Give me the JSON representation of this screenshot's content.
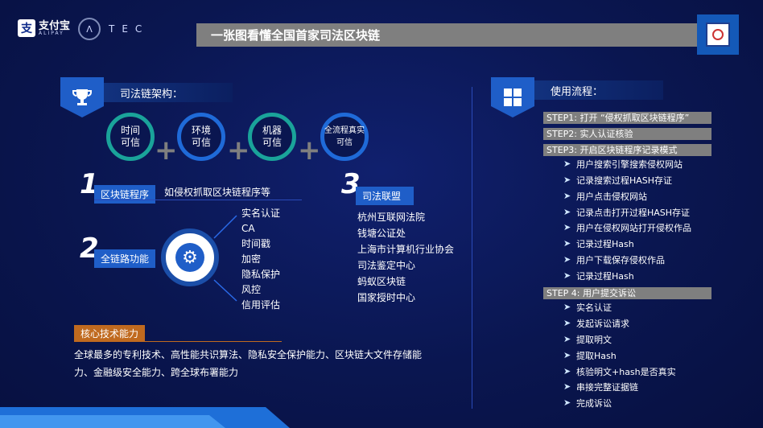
{
  "header": {
    "alipay_cn": "支付宝",
    "alipay_en": "ALIPAY",
    "alipay_mark": "支",
    "atec_mark": "Λ",
    "atec_text": "TEC",
    "title": "一张图看懂全国首家司法区块链"
  },
  "architecture": {
    "heading": "司法链架构：",
    "circles": [
      {
        "line1": "时间",
        "line2": "可信"
      },
      {
        "line1": "环境",
        "line2": "可信"
      },
      {
        "line1": "机器",
        "line2": "可信"
      },
      {
        "line1": "全流程真实",
        "line2": "可信"
      }
    ],
    "plus": "+"
  },
  "item1": {
    "num": "1",
    "tag": "区块链程序",
    "desc": "如侵权抓取区块链程序等"
  },
  "item2": {
    "num": "2",
    "tag": "全链路功能",
    "features": [
      "实名认证",
      "CA",
      "时间戳",
      "加密",
      "隐私保护",
      "风控",
      "信用评估"
    ]
  },
  "item3": {
    "num": "3",
    "tag": "司法联盟",
    "members": [
      "杭州互联网法院",
      "钱塘公证处",
      "上海市计算机行业协会",
      "司法鉴定中心",
      "蚂蚁区块链",
      "国家授时中心"
    ]
  },
  "core": {
    "tag": "核心技术能力",
    "desc_line1": "全球最多的专利技术、高性能共识算法、隐私安全保护能力、区块链大文件存储能",
    "desc_line2": "力、金融级安全能力、跨全球布署能力"
  },
  "usage": {
    "heading": "使用流程：",
    "step1": "STEP1: 打开 “侵权抓取区块链程序”",
    "step2": "STEP2: 实人认证核验",
    "step3": "STEP3: 开启区块链程序记录模式",
    "step3_items": [
      "用户搜索引擎搜索侵权网站",
      "记录搜索过程HASH存证",
      "用户点击侵权网站",
      "记录点击打开过程HASH存证",
      "用户在侵权网站打开侵权作品",
      "记录过程Hash",
      "用户下载保存侵权作品",
      "记录过程Hash"
    ],
    "step4": "STEP 4: 用户提交诉讼",
    "step4_items": [
      "实名认证",
      "发起诉讼请求",
      "提取明文",
      "提取Hash",
      "核验明文+hash是否真实",
      "串接完整证据链",
      "完成诉讼"
    ]
  },
  "colors": {
    "background": "#0a1650",
    "accent_blue": "#1f5ec8",
    "teal": "#1aa39a",
    "grey_bar": "#7f7f7f",
    "core_orange": "#c06a1f"
  },
  "icons": {
    "trophy": "trophy-icon",
    "windows": "windows-icon",
    "gear": "gear-icon",
    "arrow": "send-arrow-icon",
    "court": "court-emblem-icon"
  }
}
